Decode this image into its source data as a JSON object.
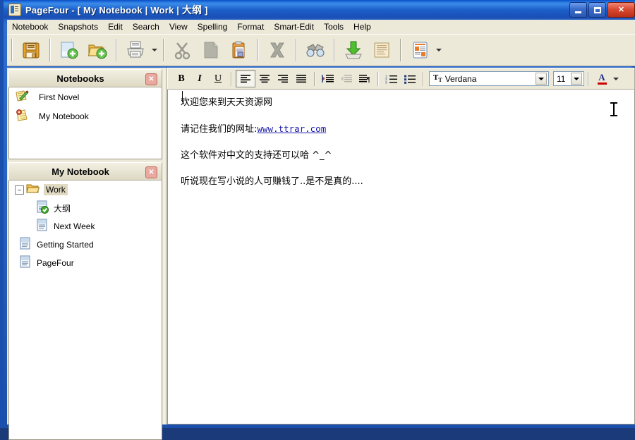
{
  "window": {
    "app_name": "PageFour",
    "title": "PageFour - [ My Notebook | Work | 大纲 ]",
    "title_prefix": "PageFour - [ My Notebook | Work | ",
    "title_suffix": " ]",
    "title_cjk": "大纲",
    "icon": "notebook-app-icon",
    "controls": {
      "minimize": "–",
      "maximize": "□",
      "close": "✕"
    }
  },
  "menubar": {
    "items": [
      {
        "label": "Notebook",
        "accel": "N"
      },
      {
        "label": "Snapshots",
        "accel": "S"
      },
      {
        "label": "Edit",
        "accel": "E"
      },
      {
        "label": "Search",
        "accel": "a"
      },
      {
        "label": "View",
        "accel": "V"
      },
      {
        "label": "Spelling",
        "accel": "p"
      },
      {
        "label": "Format",
        "accel": "F"
      },
      {
        "label": "Smart-Edit",
        "accel": "m"
      },
      {
        "label": "Tools",
        "accel": "T"
      },
      {
        "label": "Help",
        "accel": "H"
      }
    ]
  },
  "toolbar": {
    "buttons": [
      {
        "name": "save-button",
        "icon": "floppy-disk-icon",
        "tooltip": "Save"
      },
      {
        "name": "new-page-button",
        "icon": "new-page-icon",
        "tooltip": "New Page"
      },
      {
        "name": "new-folder-button",
        "icon": "new-folder-icon",
        "tooltip": "New Folder"
      },
      {
        "name": "print-button",
        "icon": "printer-icon",
        "tooltip": "Print"
      },
      {
        "name": "cut-button",
        "icon": "scissors-icon",
        "tooltip": "Cut"
      },
      {
        "name": "copy-button",
        "icon": "copy-icon",
        "tooltip": "Copy"
      },
      {
        "name": "paste-button",
        "icon": "clipboard-paste-icon",
        "tooltip": "Paste"
      },
      {
        "name": "delete-button",
        "icon": "x-cross-icon",
        "tooltip": "Delete"
      },
      {
        "name": "find-button",
        "icon": "binoculars-icon",
        "tooltip": "Find"
      },
      {
        "name": "import-button",
        "icon": "green-down-arrow-tray-icon",
        "tooltip": "Import"
      },
      {
        "name": "notes-button",
        "icon": "note-paper-icon",
        "tooltip": "Notes"
      },
      {
        "name": "templates-button",
        "icon": "layout-template-icon",
        "tooltip": "Templates"
      }
    ]
  },
  "formatbar": {
    "bold": "B",
    "italic": "I",
    "underline": "U",
    "align_left": "align-left",
    "align_center": "align-center",
    "align_right": "align-right",
    "align_justify": "align-justify",
    "indent_increase": "indent-increase",
    "indent_decrease": "indent-decrease",
    "paragraph_direction": "paragraph-direction",
    "numbered_list": "numbered-list",
    "bullet_list": "bullet-list",
    "font_name": "Verdana",
    "font_size": "11",
    "font_color_letter": "A",
    "font_color": "#cc0000",
    "active_alignment": "align-left"
  },
  "notebooks_panel": {
    "title": "Notebooks",
    "close_label": "✕",
    "items": [
      {
        "label": "First Novel",
        "icon": "notepad-pencil-icon"
      },
      {
        "label": "My Notebook",
        "icon": "notepad-seal-icon"
      }
    ]
  },
  "tree_panel": {
    "title": "My Notebook",
    "close_label": "✕",
    "items": [
      {
        "label": "Work",
        "icon": "open-folder-icon",
        "level": 0,
        "expander": "–",
        "selected": true
      },
      {
        "label": "大纲",
        "icon": "page-check-icon",
        "level": 1,
        "selected": false
      },
      {
        "label": "Next Week",
        "icon": "page-icon",
        "level": 1,
        "selected": false
      },
      {
        "label": "Getting Started",
        "icon": "page-icon",
        "level": 0,
        "selected": false
      },
      {
        "label": "PageFour",
        "icon": "page-icon",
        "level": 0,
        "selected": false
      }
    ]
  },
  "editor": {
    "paragraphs": [
      {
        "text": "欢迎您来到天天资源网",
        "link": null,
        "link_text": null
      },
      {
        "text": "请记住我们的网址:",
        "link": "www.ttrar.com",
        "link_text": "www.ttrar.com"
      },
      {
        "text": "这个软件对中文的支持还可以哈  ^_^",
        "link": null,
        "link_text": null
      },
      {
        "text": "听说现在写小说的人可赚钱了..是不是真的....",
        "link": null,
        "link_text": null
      }
    ],
    "line1": "欢迎您来到天天资源网",
    "line2_prefix": "请记住我们的网址:",
    "line2_link": "www.ttrar.com",
    "line3": "这个软件对中文的支持还可以哈  ^_^",
    "line4": "听说现在写小说的人可赚钱了..是不是真的....",
    "cursor": "i-beam-pointer"
  },
  "colors": {
    "titlebar_blue": "#1b4fae",
    "chrome": "#ece9d8",
    "panel_border": "#9a9684",
    "link": "#1a1aa8",
    "close_red": "#d94a32",
    "selection": "#ded9c0"
  }
}
